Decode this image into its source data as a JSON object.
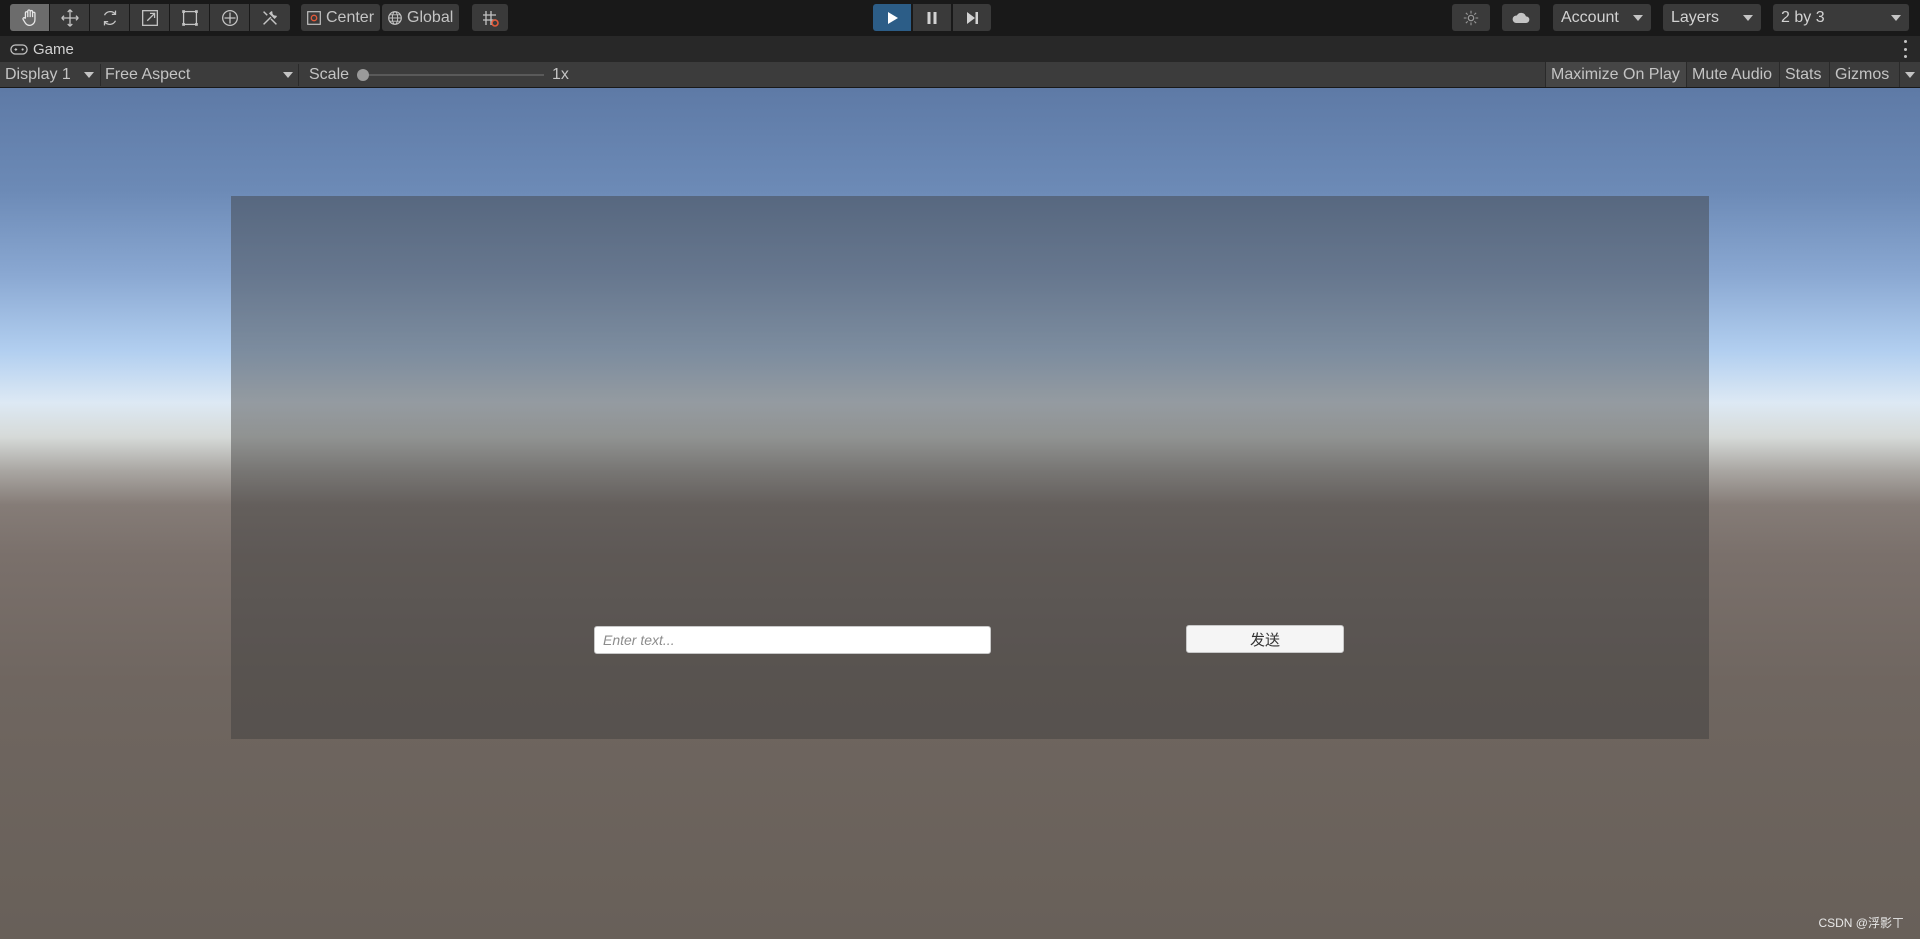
{
  "toolbar": {
    "tools": [
      {
        "name": "hand-tool",
        "icon": "hand-icon",
        "active": true
      },
      {
        "name": "move-tool",
        "icon": "move-icon",
        "active": false
      },
      {
        "name": "rotate-tool",
        "icon": "rotate-icon",
        "active": false
      },
      {
        "name": "scale-tool",
        "icon": "scale-icon",
        "active": false
      },
      {
        "name": "rect-tool",
        "icon": "rect-transform-icon",
        "active": false
      },
      {
        "name": "transform-tool",
        "icon": "transform-icon",
        "active": false
      },
      {
        "name": "custom-tool",
        "icon": "tools-icon",
        "active": false
      }
    ],
    "pivot_label": "Center",
    "space_label": "Global",
    "account_label": "Account",
    "layers_label": "Layers",
    "layout_label": "2 by 3",
    "accent_color": "#2c5d87"
  },
  "tab": {
    "title": "Game",
    "icon": "gamepad-icon"
  },
  "gamebar": {
    "display": "Display 1",
    "aspect": "Free Aspect",
    "scale_label": "Scale",
    "scale_value": "1x",
    "maximize": "Maximize On Play",
    "mute": "Mute Audio",
    "stats": "Stats",
    "gizmos": "Gizmos"
  },
  "game_ui": {
    "input_placeholder": "Enter text...",
    "send_label": "发送"
  },
  "watermark": "CSDN @浮影ㄒ"
}
